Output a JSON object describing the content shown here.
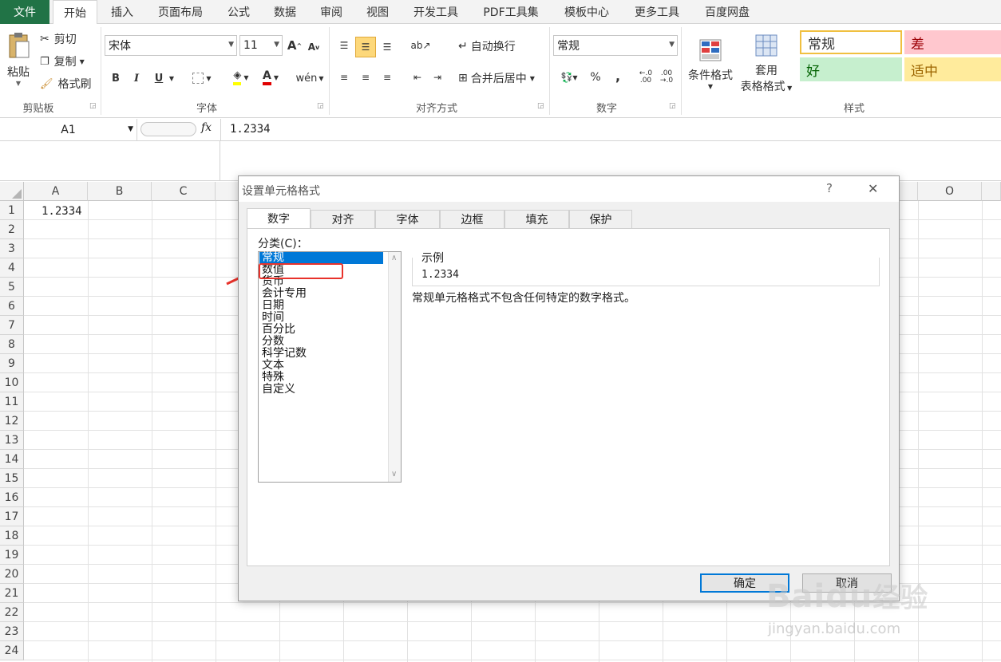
{
  "ribbon_tabs": [
    "开始",
    "插入",
    "页面布局",
    "公式",
    "数据",
    "审阅",
    "视图",
    "开发工具",
    "PDF工具集",
    "模板中心",
    "更多工具",
    "百度网盘"
  ],
  "file_tab": "文件",
  "clipboard": {
    "paste": "粘贴",
    "cut": "剪切",
    "copy": "复制",
    "format_painter": "格式刷",
    "group": "剪贴板"
  },
  "font": {
    "name": "宋体",
    "size": "11",
    "bold": "B",
    "italic": "I",
    "underline": "U",
    "grow": "A",
    "shrink": "A",
    "wen": "wén",
    "group": "字体"
  },
  "alignment": {
    "wrap": "自动换行",
    "merge": "合并后居中",
    "group": "对齐方式"
  },
  "number": {
    "format": "常规",
    "percent": "%",
    "comma": ",",
    "inc": "←.0 .00",
    "dec": ".00 →.0",
    "group": "数字"
  },
  "styles": {
    "cond_format": "条件格式",
    "table_format_1": "套用",
    "table_format_2": "表格格式",
    "normal": "常规",
    "bad": "差",
    "good": "好",
    "neutral": "适中",
    "group": "样式"
  },
  "formula_bar": {
    "name_box": "A1",
    "fx": "fx",
    "value": "1.2334"
  },
  "columns": [
    "A",
    "B",
    "C",
    "O"
  ],
  "rows": [
    "1",
    "2",
    "3",
    "4",
    "5",
    "6",
    "7",
    "8",
    "9",
    "10",
    "11",
    "12",
    "13",
    "14",
    "15",
    "16",
    "17",
    "18",
    "19",
    "20",
    "21",
    "22",
    "23",
    "24"
  ],
  "cell_a1": "1.2334",
  "dialog": {
    "title": "设置单元格格式",
    "help": "?",
    "close": "✕",
    "tabs": [
      "数字",
      "对齐",
      "字体",
      "边框",
      "填充",
      "保护"
    ],
    "category_label": "分类(C)：",
    "categories": [
      "常规",
      "数值",
      "货币",
      "会计专用",
      "日期",
      "时间",
      "百分比",
      "分数",
      "科学记数",
      "文本",
      "特殊",
      "自定义"
    ],
    "sample_label": "示例",
    "sample_value": "1.2334",
    "description": "常规单元格格式不包含任何特定的数字格式。",
    "ok": "确定",
    "cancel": "取消"
  },
  "watermark": {
    "brand": "Baidu",
    "brand_cn": "经验",
    "url": "jingyan.baidu.com"
  },
  "colors": {
    "excel_green": "#217346",
    "selection_blue": "#0078d7",
    "highlight_red": "#e8322b"
  }
}
